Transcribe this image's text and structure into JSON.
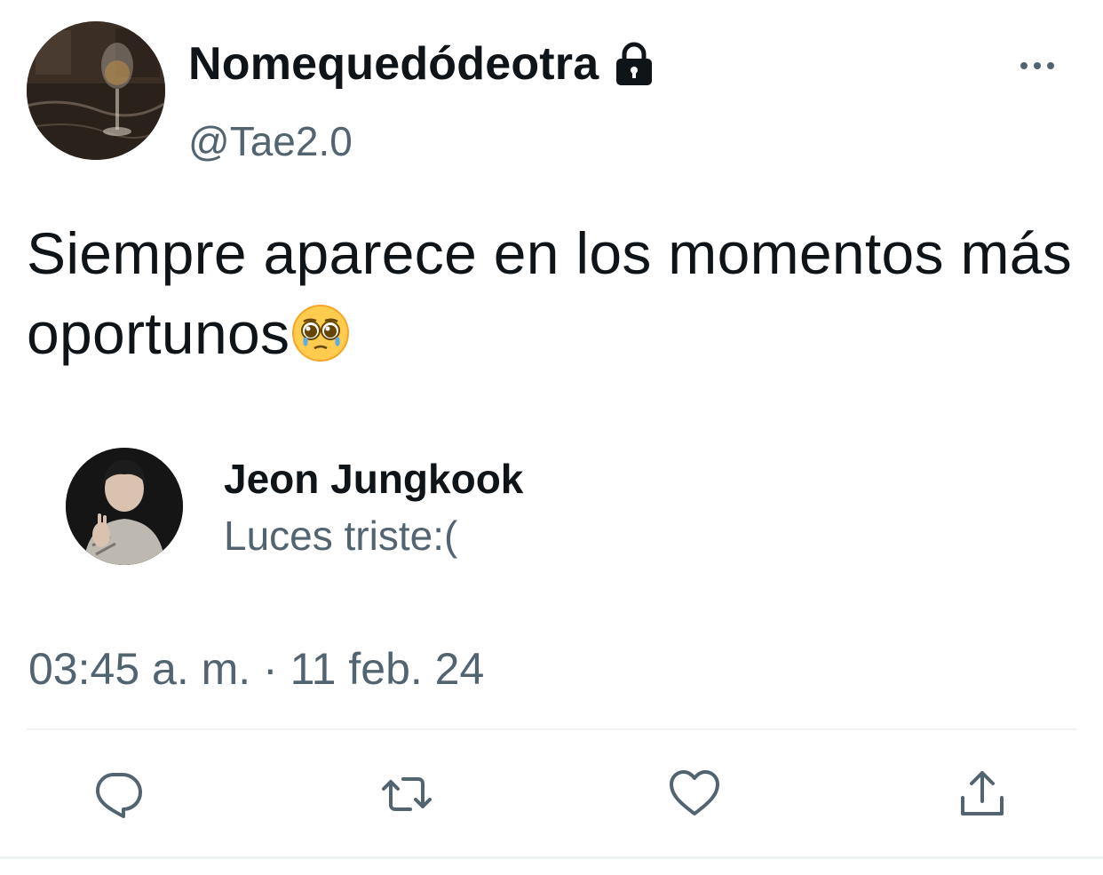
{
  "author": {
    "display_name": "Nomequedódeotra",
    "handle": "@Tae2.0",
    "protected": true,
    "avatar_icon": "wine-glass-avatar"
  },
  "tweet": {
    "text": "Siempre aparece en los momentos más oportunos",
    "emoji": "pleading-face-emoji"
  },
  "quoted": {
    "name": "Jeon Jungkook",
    "text": "Luces triste:(",
    "avatar_icon": "person-avatar"
  },
  "meta": {
    "timestamp": "03:45 a. m. · 11 feb. 24"
  },
  "actions": {
    "reply_icon": "reply-icon",
    "retweet_icon": "retweet-icon",
    "like_icon": "heart-icon",
    "share_icon": "share-icon",
    "more_icon": "more-icon"
  },
  "colors": {
    "text_primary": "#0f1419",
    "text_secondary": "#536471",
    "divider": "#eff3f4"
  }
}
